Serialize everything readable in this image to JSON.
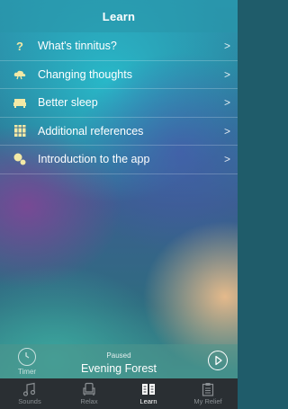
{
  "header": {
    "title": "Learn"
  },
  "menu": {
    "items": [
      {
        "label": "What's tinnitus?",
        "icon": "question-icon",
        "chevron": ">"
      },
      {
        "label": "Changing thoughts",
        "icon": "cloud-icon",
        "chevron": ">"
      },
      {
        "label": "Better sleep",
        "icon": "bed-icon",
        "chevron": ">"
      },
      {
        "label": "Additional references",
        "icon": "books-icon",
        "chevron": ">"
      },
      {
        "label": "Introduction to the app",
        "icon": "chat-bubbles-icon",
        "chevron": ">"
      }
    ],
    "icon_color": "#f2e9a6"
  },
  "player": {
    "timer_label": "Timer",
    "status": "Paused",
    "track": "Evening Forest"
  },
  "tabbar": {
    "tabs": [
      {
        "label": "Sounds",
        "icon": "music-note-icon",
        "active": false
      },
      {
        "label": "Relax",
        "icon": "armchair-icon",
        "active": false
      },
      {
        "label": "Learn",
        "icon": "book-icon",
        "active": true
      },
      {
        "label": "My Relief",
        "icon": "clipboard-icon",
        "active": false
      }
    ]
  }
}
